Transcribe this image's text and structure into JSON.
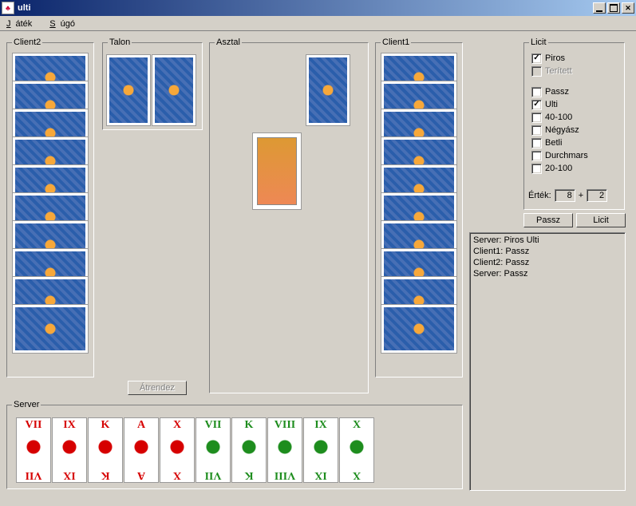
{
  "window": {
    "title": "ulti"
  },
  "menu": {
    "jatek": "Játék",
    "sugo": "Súgó"
  },
  "groups": {
    "client2": "Client2",
    "talon": "Talon",
    "asztal": "Asztal",
    "client1": "Client1",
    "licit": "Licit",
    "server": "Server"
  },
  "buttons": {
    "atrendez": "Átrendez",
    "passz": "Passz",
    "licit": "Licit"
  },
  "licit": {
    "piros": {
      "label": "Piros",
      "checked": true,
      "disabled": false
    },
    "teritett": {
      "label": "Terített",
      "checked": false,
      "disabled": true
    },
    "passz": {
      "label": "Passz",
      "checked": false,
      "disabled": false
    },
    "ulti": {
      "label": "Ulti",
      "checked": true,
      "disabled": false
    },
    "n40_100": {
      "label": "40-100",
      "checked": false,
      "disabled": false
    },
    "negyasz": {
      "label": "Négyász",
      "checked": false,
      "disabled": false
    },
    "betli": {
      "label": "Betli",
      "checked": false,
      "disabled": false
    },
    "durchmars": {
      "label": "Durchmars",
      "checked": false,
      "disabled": false
    },
    "n20_100": {
      "label": "20-100",
      "checked": false,
      "disabled": false
    },
    "ertek_label": "Érték:",
    "ertek_base": "8",
    "ertek_plus": "+",
    "ertek_extra": "2"
  },
  "log": {
    "lines": [
      "Server: Piros Ulti",
      "Client1: Passz",
      "Client2: Passz",
      "Server: Passz"
    ]
  },
  "hands": {
    "client2_count": 10,
    "client1_count": 10,
    "talon_count": 2,
    "asztal_back": 1,
    "asztal_face": 1,
    "server": [
      {
        "rank": "VII",
        "suit": "red"
      },
      {
        "rank": "IX",
        "suit": "red"
      },
      {
        "rank": "K",
        "suit": "red"
      },
      {
        "rank": "A",
        "suit": "red"
      },
      {
        "rank": "X",
        "suit": "red"
      },
      {
        "rank": "VII",
        "suit": "green"
      },
      {
        "rank": "K",
        "suit": "green"
      },
      {
        "rank": "VIII",
        "suit": "green"
      },
      {
        "rank": "IX",
        "suit": "green"
      },
      {
        "rank": "X",
        "suit": "green"
      }
    ]
  }
}
